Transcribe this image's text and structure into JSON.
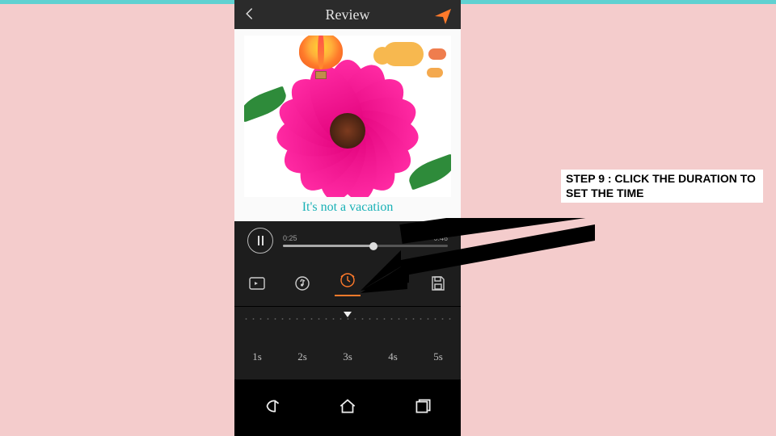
{
  "instruction": {
    "text": "STEP 9 : CLICK THE DURATION TO SET THE TIME"
  },
  "titlebar": {
    "title": "Review"
  },
  "preview": {
    "caption": "It's not a vacation"
  },
  "player": {
    "elapsed": "0:25",
    "total": "0:46",
    "progress_pct": 55
  },
  "tools": {
    "selected_index": 2,
    "items": [
      {
        "name": "transition-icon"
      },
      {
        "name": "music-icon"
      },
      {
        "name": "duration-icon"
      },
      {
        "name": "trim-icon"
      },
      {
        "name": "save-icon"
      }
    ]
  },
  "durations": {
    "options": [
      "1s",
      "2s",
      "3s",
      "4s",
      "5s"
    ],
    "selected": "3s"
  },
  "colors": {
    "accent": "#ff7a2b"
  }
}
